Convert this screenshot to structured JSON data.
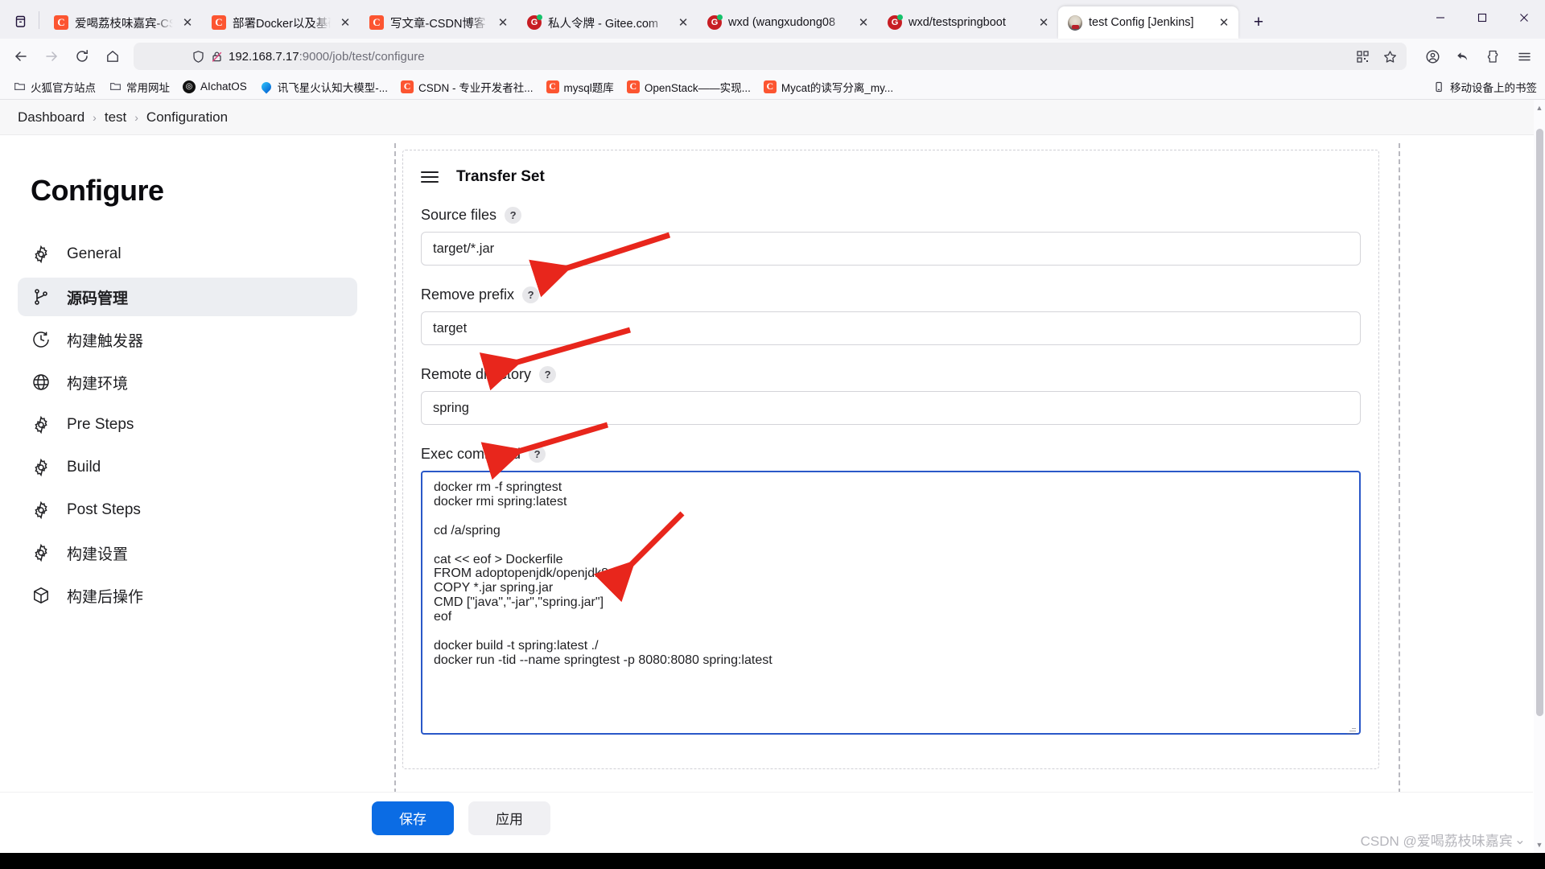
{
  "browser": {
    "tab_list_icon": "tab-list-icon",
    "tabs": [
      {
        "title": "爱喝荔枝味嘉宾-CSDN",
        "favicon": "csdn-icon",
        "active": false
      },
      {
        "title": "部署Docker以及基础台",
        "favicon": "csdn-icon",
        "active": false
      },
      {
        "title": "写文章-CSDN博客",
        "favicon": "csdn-icon",
        "active": false
      },
      {
        "title": "私人令牌 - Gitee.com",
        "favicon": "gitee-icon",
        "active": false
      },
      {
        "title": "wxd (wangxudong08",
        "favicon": "gitee-icon",
        "active": false
      },
      {
        "title": "wxd/testspringboot",
        "favicon": "gitee-icon",
        "active": false
      },
      {
        "title": "test Config [Jenkins]",
        "favicon": "jenkins-icon",
        "active": true
      }
    ],
    "close_glyph": "✕",
    "newtab_label": "+",
    "window_controls": {
      "minimize": "—",
      "maximize": "▢",
      "close": "✕"
    },
    "nav": {
      "back": "←",
      "forward": "→",
      "reload": "⟳",
      "home": "⌂"
    },
    "url": {
      "host": "192.168.7.17",
      "path": ":9000/job/test/configure"
    },
    "url_icons": [
      "shield-icon",
      "broken-lock-icon",
      "qr-code-icon",
      "star-icon"
    ],
    "toolbar_icons": [
      "account-icon",
      "undo-icon",
      "extensions-icon",
      "app-menu-icon"
    ],
    "bookmarks": [
      {
        "label": "火狐官方站点",
        "icon": "folder-icon"
      },
      {
        "label": "常用网址",
        "icon": "folder-icon"
      },
      {
        "label": "AIchatOS",
        "icon": "aichatos-icon"
      },
      {
        "label": "讯飞星火认知大模型-...",
        "icon": "spark-icon"
      },
      {
        "label": "CSDN - 专业开发者社...",
        "icon": "csdn-icon"
      },
      {
        "label": "mysql题库",
        "icon": "csdn-icon"
      },
      {
        "label": "OpenStack——实现...",
        "icon": "csdn-icon"
      },
      {
        "label": "Mycat的读写分离_my...",
        "icon": "csdn-icon"
      }
    ],
    "bookmarks_right": {
      "label": "移动设备上的书签",
      "icon": "mobile-icon"
    }
  },
  "jenkins": {
    "breadcrumb": {
      "items": [
        "Dashboard",
        "test",
        "Configuration"
      ],
      "separator": "›"
    },
    "sidebar": {
      "title": "Configure",
      "items": [
        {
          "label": "General",
          "icon": "gear-icon",
          "active": false
        },
        {
          "label": "源码管理",
          "icon": "branch-icon",
          "active": true
        },
        {
          "label": "构建触发器",
          "icon": "clock-icon",
          "active": false
        },
        {
          "label": "构建环境",
          "icon": "globe-icon",
          "active": false
        },
        {
          "label": "Pre Steps",
          "icon": "gear-icon",
          "active": false
        },
        {
          "label": "Build",
          "icon": "gear-icon",
          "active": false
        },
        {
          "label": "Post Steps",
          "icon": "gear-icon",
          "active": false
        },
        {
          "label": "构建设置",
          "icon": "gear-icon",
          "active": false
        },
        {
          "label": "构建后操作",
          "icon": "package-icon",
          "active": false
        }
      ]
    },
    "transfer_set": {
      "heading": "Transfer Set",
      "drag_handle_icon": "drag-handle-icon",
      "help_glyph": "?",
      "fields": [
        {
          "label": "Source files",
          "value": "target/*.jar",
          "placeholder": ""
        },
        {
          "label": "Remove prefix",
          "value": "target",
          "placeholder": ""
        },
        {
          "label": "Remote directory",
          "value": "spring",
          "placeholder": ""
        }
      ],
      "exec": {
        "label": "Exec command",
        "value": "docker rm -f springtest\ndocker rmi spring:latest\n\ncd /a/spring\n\ncat << eof > Dockerfile\nFROM adoptopenjdk/openjdk8\nCOPY *.jar spring.jar\nCMD [\"java\",\"-jar\",\"spring.jar\"]\neof\n\ndocker build -t spring:latest ./\ndocker run -tid --name springtest -p 8080:8080 spring:latest"
      }
    },
    "footer": {
      "save_label": "保存",
      "apply_label": "应用"
    }
  },
  "watermark": {
    "text": "CSDN @爱喝荔枝味嘉宾",
    "chevron": "⌄"
  },
  "colors": {
    "accent_blue": "#0b6ce4",
    "textarea_focus_border": "#2a58c8",
    "csdn_orange": "#fc5531",
    "gitee_red": "#c71d23",
    "annotation_red": "#e8261c",
    "sidebar_active_bg": "#eceef2"
  }
}
